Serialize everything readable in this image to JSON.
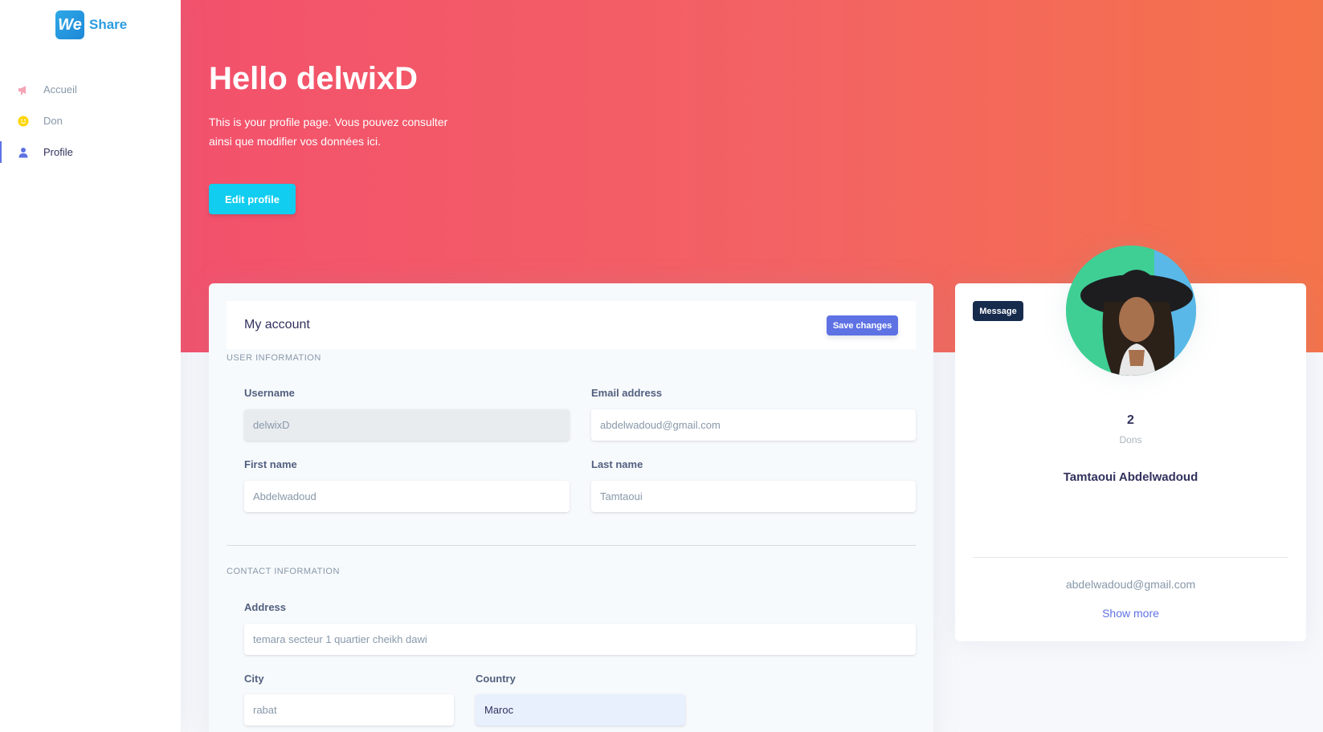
{
  "brand": {
    "badge": "We",
    "name": "Share"
  },
  "nav": {
    "items": [
      {
        "label": "Accueil",
        "icon": "megaphone-icon",
        "color": "#f3a4b5"
      },
      {
        "label": "Don",
        "icon": "smile-icon",
        "color": "#ffd600"
      },
      {
        "label": "Profile",
        "icon": "user-icon",
        "color": "#5e72e4"
      }
    ],
    "active": "Profile"
  },
  "header": {
    "greeting": "Hello delwixD",
    "subtitle": "This is your profile page. Vous pouvez consulter ainsi que modifier vos données ici.",
    "edit_button": "Edit profile"
  },
  "account": {
    "title": "My account",
    "save_button": "Save changes",
    "user_section": "USER INFORMATION",
    "contact_section": "CONTACT INFORMATION",
    "fields": {
      "username": {
        "label": "Username",
        "value": "delwixD"
      },
      "email": {
        "label": "Email address",
        "value": "abdelwadoud@gmail.com"
      },
      "first_name": {
        "label": "First name",
        "value": "Abdelwadoud"
      },
      "last_name": {
        "label": "Last name",
        "value": "Tamtaoui"
      },
      "address": {
        "label": "Address",
        "value": "temara secteur 1 quartier cheikh dawi"
      },
      "city": {
        "label": "City",
        "value": "rabat"
      },
      "country": {
        "label": "Country",
        "value": "Maroc"
      }
    }
  },
  "profile_card": {
    "message_button": "Message",
    "stat_value": "2",
    "stat_label": "Dons",
    "full_name": "Tamtaoui Abdelwadoud",
    "email": "abdelwadoud@gmail.com",
    "show_more": "Show more"
  },
  "colors": {
    "primary": "#5e72e4",
    "info": "#11cdef",
    "header_start": "#f3516c",
    "header_end": "#f5734a"
  }
}
